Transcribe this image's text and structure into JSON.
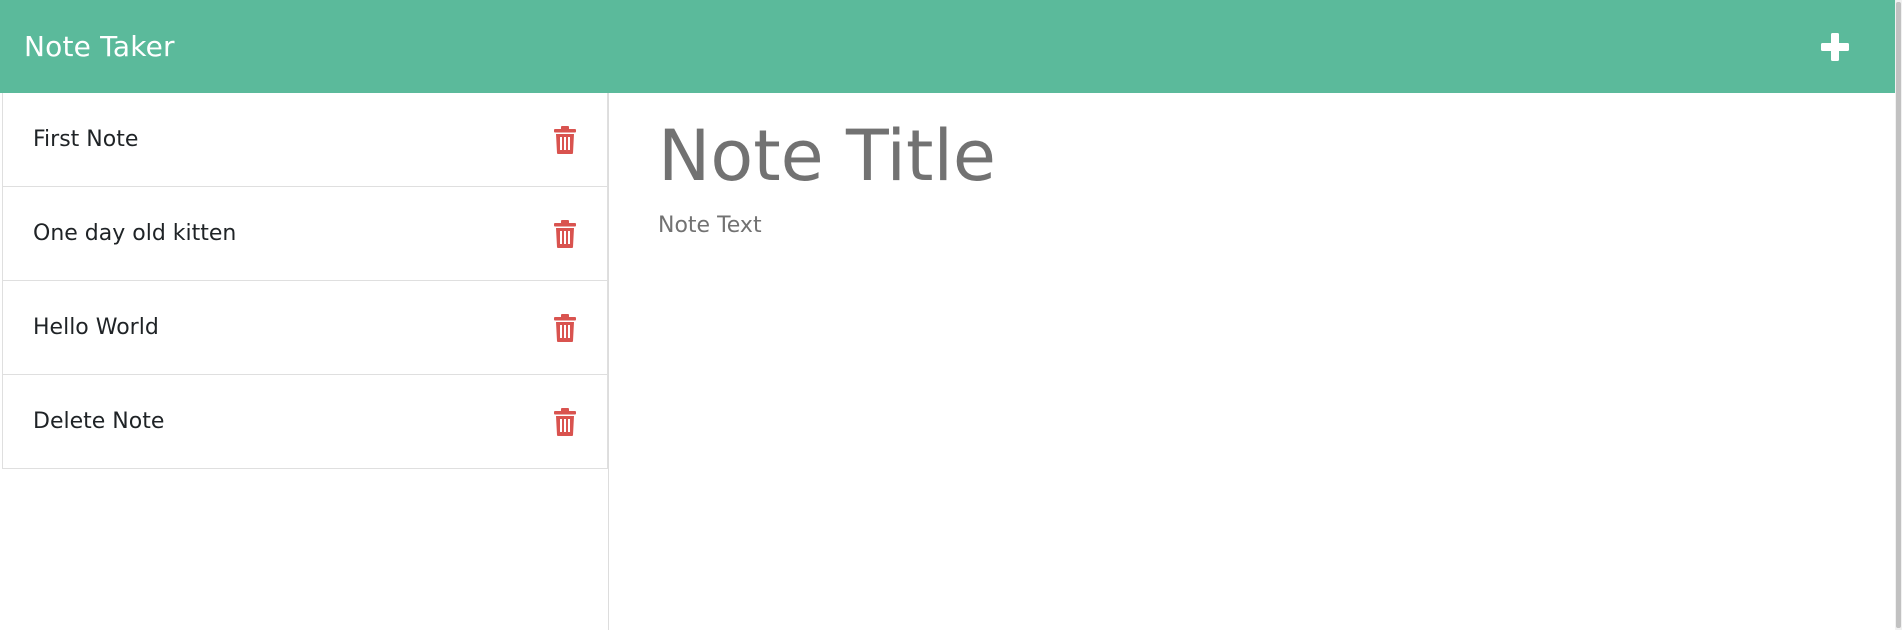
{
  "app": {
    "brand": "Note Taker",
    "accent_color": "#5bba9b",
    "delete_color": "#d9534f"
  },
  "header": {
    "add_icon": "plus-icon"
  },
  "notes": [
    {
      "title": "First Note",
      "icon": "trash-icon"
    },
    {
      "title": "One day old kitten",
      "icon": "trash-icon"
    },
    {
      "title": "Hello World",
      "icon": "trash-icon"
    },
    {
      "title": "Delete Note",
      "icon": "trash-icon"
    }
  ],
  "editor": {
    "title_placeholder": "Note Title",
    "text_placeholder": "Note Text"
  }
}
